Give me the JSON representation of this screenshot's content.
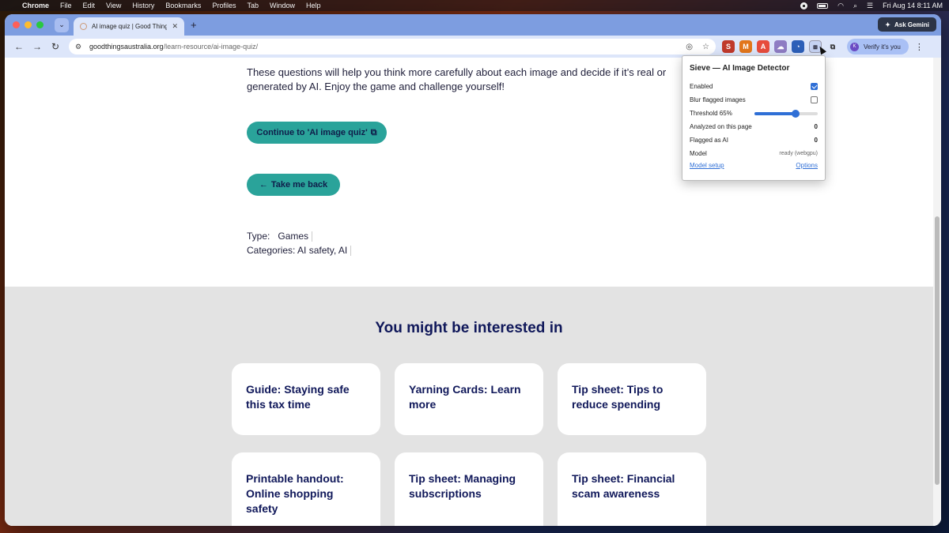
{
  "menubar": {
    "app": "Chrome",
    "items": [
      "File",
      "Edit",
      "View",
      "History",
      "Bookmarks",
      "Profiles",
      "Tab",
      "Window",
      "Help"
    ],
    "datetime": "Fri Aug 14  8:11 AM"
  },
  "browser": {
    "tab_title": "AI image quiz | Good Things F",
    "new_tab": "+",
    "ask_gemini": "Ask Gemini",
    "url_domain": "goodthingsaustralia.org",
    "url_path": "/learn-resource/ai-image-quiz/",
    "verify_label": "Verify it's you",
    "extensions": [
      {
        "name": "s-extension-icon",
        "glyph": "S",
        "color": "#c0392b"
      },
      {
        "name": "metamask-icon",
        "glyph": "M",
        "color": "#e2761b"
      },
      {
        "name": "acrobat-icon",
        "glyph": "A",
        "color": "#e74c3c"
      },
      {
        "name": "cloud-icon",
        "glyph": "☁",
        "color": "#8e7cc3"
      },
      {
        "name": "speed-icon",
        "glyph": "◔",
        "color": "#2c5fb8"
      }
    ]
  },
  "page": {
    "intro": "These questions will help you think more carefully about each image and decide if it’s real or generated by AI. Enjoy the game and challenge yourself!",
    "continue_label": "Continue to 'AI image quiz'",
    "back_label": "Take me back",
    "type_label": "Type:",
    "type_value": "Games",
    "categories_label": "Categories:",
    "categories_value": "AI safety, AI",
    "related_title": "You might be interested in",
    "cards": [
      "Guide: Staying safe this tax time",
      "Yarning Cards: Learn more",
      "Tip sheet: Tips to reduce spending",
      "Printable handout: Online shopping safety",
      "Tip sheet: Managing subscriptions",
      "Tip sheet: Financial scam awareness"
    ]
  },
  "popup": {
    "title": "Sieve — AI Image Detector",
    "enabled_label": "Enabled",
    "enabled": true,
    "blur_label": "Blur flagged images",
    "blur": false,
    "threshold_label": "Threshold 65%",
    "threshold_value": 0.65,
    "analyzed_label": "Analyzed on this page",
    "analyzed_value": "0",
    "flagged_label": "Flagged as AI",
    "flagged_value": "0",
    "model_label": "Model",
    "model_value": "ready (webgpu)",
    "model_setup_link": "Model setup",
    "options_link": "Options"
  }
}
